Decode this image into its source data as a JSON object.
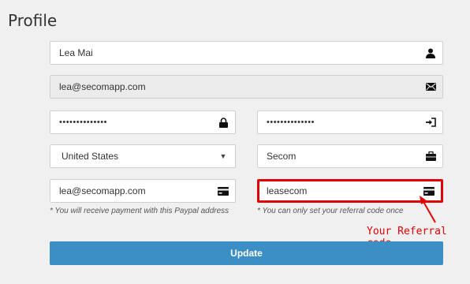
{
  "page": {
    "title": "Profile"
  },
  "form": {
    "name": "Lea Mai",
    "email": "lea@secomapp.com",
    "password": "••••••••••••••",
    "password_confirm": "••••••••••••••",
    "country": "United States",
    "company": "Secom",
    "paypal_email": "lea@secomapp.com",
    "paypal_hint": "* You will receive payment with this Paypal address",
    "referral_code": "leasecom",
    "referral_hint": "* You can only set your referral code once",
    "update_label": "Update"
  },
  "annotation": {
    "label": "Your Referral code",
    "color": "#e00000"
  },
  "icons": {
    "name": "user-icon",
    "email": "envelope-icon",
    "password": "lock-icon",
    "password_confirm": "sign-in-icon",
    "country": "caret-down-icon",
    "company": "briefcase-icon",
    "paypal": "credit-card-icon",
    "referral": "credit-card-icon"
  },
  "colors": {
    "button": "#3b8fc4",
    "background": "#f0f0f0",
    "highlight": "#e00000"
  }
}
